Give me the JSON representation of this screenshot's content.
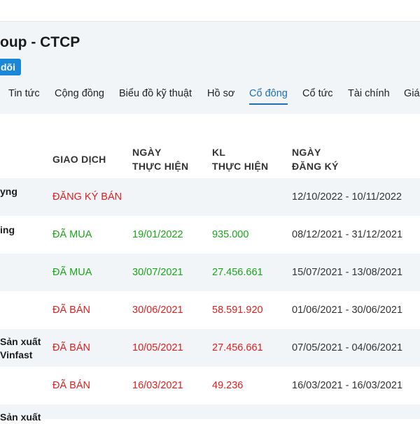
{
  "header": {
    "company_title": "oup - CTCP",
    "follow_label": "dõi"
  },
  "tabs": [
    {
      "label": "Tin tức",
      "active": false
    },
    {
      "label": "Cộng đồng",
      "active": false
    },
    {
      "label": "Biểu đồ kỹ thuật",
      "active": false
    },
    {
      "label": "Hồ sơ",
      "active": false
    },
    {
      "label": "Cổ đông",
      "active": true
    },
    {
      "label": "Cổ tức",
      "active": false
    },
    {
      "label": "Tài chính",
      "active": false
    },
    {
      "label": "Giá",
      "active": false
    }
  ],
  "table": {
    "headers": {
      "transaction": "GIAO DỊCH",
      "exec_date_line1": "NGÀY",
      "exec_date_line2": "THỰC HIỆN",
      "volume_line1": "KL",
      "volume_line2": "THỰC HIỆN",
      "reg_date_line1": "NGÀY",
      "reg_date_line2": "ĐĂNG KÝ"
    },
    "rows": [
      {
        "name_line1": "yng",
        "name_line2": "",
        "transaction": "ĐĂNG KÝ BÁN",
        "type": "sell",
        "exec_date": "",
        "volume": "",
        "reg_period": "12/10/2022 - 10/11/2022"
      },
      {
        "name_line1": "ing",
        "name_line2": "",
        "transaction": "ĐÃ MUA",
        "type": "buy",
        "exec_date": "19/01/2022",
        "volume": "935.000",
        "reg_period": "08/12/2021 - 31/12/2021"
      },
      {
        "name_line1": "",
        "name_line2": "",
        "transaction": "ĐÃ MUA",
        "type": "buy",
        "exec_date": "30/07/2021",
        "volume": "27.456.661",
        "reg_period": "15/07/2021 - 13/08/2021"
      },
      {
        "name_line1": "",
        "name_line2": "",
        "transaction": "ĐÃ BÁN",
        "type": "sell",
        "exec_date": "30/06/2021",
        "volume": "58.591.920",
        "reg_period": "01/06/2021 - 30/06/2021"
      },
      {
        "name_line1": "Sản xuất",
        "name_line2": "Vinfast",
        "transaction": "ĐÃ BÁN",
        "type": "sell",
        "exec_date": "10/05/2021",
        "volume": "27.456.661",
        "reg_period": "07/05/2021 - 04/06/2021"
      },
      {
        "name_line1": "",
        "name_line2": "",
        "transaction": "ĐÃ BÁN",
        "type": "sell",
        "exec_date": "16/03/2021",
        "volume": "49.236",
        "reg_period": "16/03/2021 - 16/03/2021"
      },
      {
        "name_line1": "Sản xuất",
        "name_line2": "",
        "transaction": "",
        "type": "buy",
        "exec_date": "",
        "volume": "",
        "reg_period": ""
      }
    ]
  },
  "colors": {
    "buy": "#1aa51a",
    "sell": "#e02020",
    "accent": "#1a6fb5",
    "button": "#1a87d9"
  }
}
